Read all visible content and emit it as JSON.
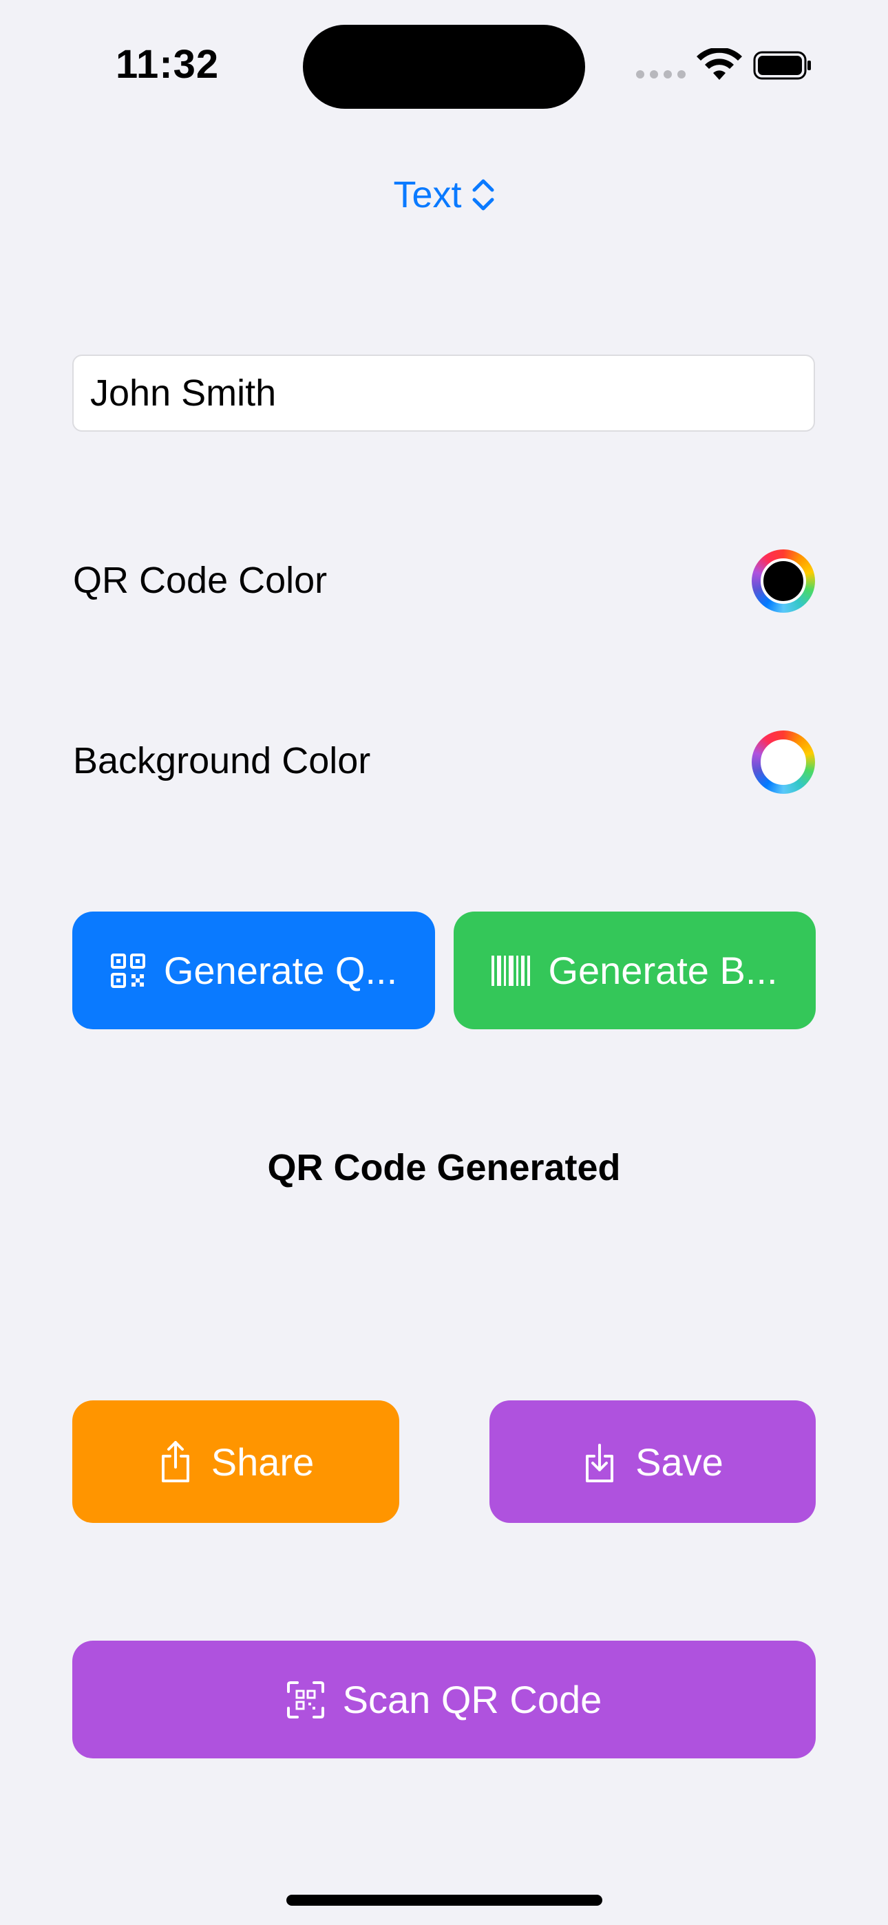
{
  "status_bar": {
    "time": "11:32",
    "icons": [
      "cellular-dots-icon",
      "wifi-icon",
      "battery-icon"
    ]
  },
  "picker": {
    "label": "Text",
    "icon": "chevron-up-down-icon",
    "color": "#0a7aff"
  },
  "input": {
    "value": "John Smith",
    "placeholder": ""
  },
  "qr_color": {
    "label": "QR Code Color",
    "value": "#000000"
  },
  "background_color": {
    "label": "Background Color",
    "value": "#ffffff"
  },
  "buttons": {
    "generate_qr": {
      "label": "Generate Q...",
      "icon": "qrcode-icon",
      "color": "#0a7aff"
    },
    "generate_barcode": {
      "label": "Generate B...",
      "icon": "barcode-icon",
      "color": "#34c759"
    },
    "share": {
      "label": "Share",
      "icon": "share-icon",
      "color": "#ff9500"
    },
    "save": {
      "label": "Save",
      "icon": "download-icon",
      "color": "#af52de"
    },
    "scan": {
      "label": "Scan QR Code",
      "icon": "qrcode-viewfinder-icon",
      "color": "#af52de"
    }
  },
  "result": {
    "title": "QR Code Generated"
  }
}
